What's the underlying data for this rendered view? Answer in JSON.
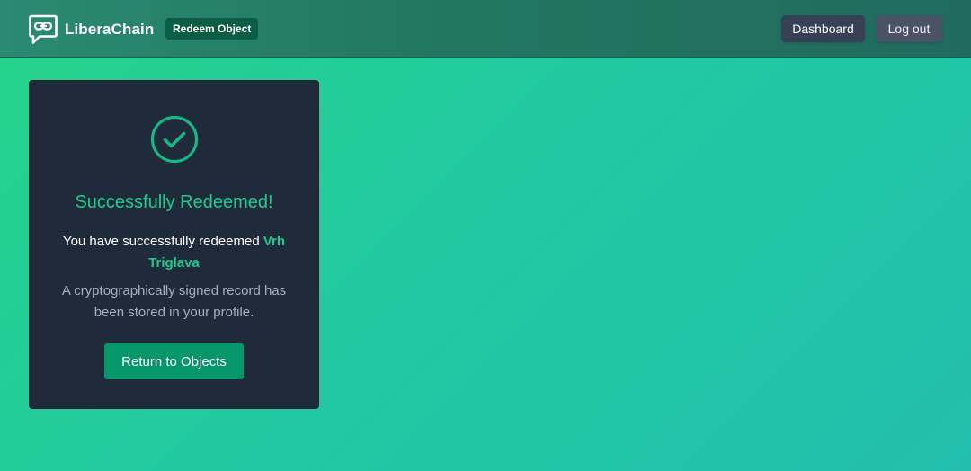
{
  "header": {
    "brand_name": "LiberaChain",
    "brand_icon": "chat-link-icon",
    "page_badge": "Redeem Object",
    "nav": {
      "dashboard_label": "Dashboard",
      "logout_label": "Log out"
    }
  },
  "card": {
    "status_icon": "check-circle-icon",
    "title": "Successfully Redeemed!",
    "message_prefix": "You have successfully redeemed ",
    "object_name": "Vrh Triglava",
    "record_message": "A cryptographically signed record has been stored in your profile.",
    "return_button_label": "Return to Objects"
  },
  "colors": {
    "accent": "#1dcc8f",
    "card_bg": "#1f2a3b",
    "button_primary": "#059669",
    "badge_bg": "#0b5e45"
  }
}
